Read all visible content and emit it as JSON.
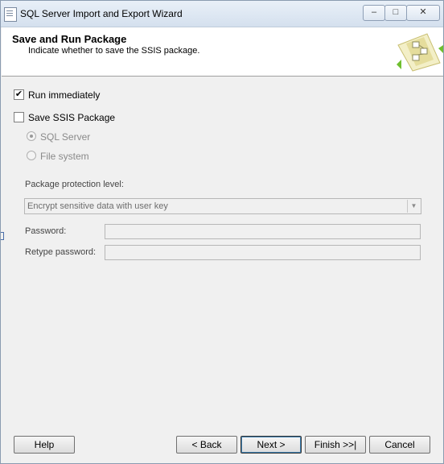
{
  "window": {
    "title": "SQL Server Import and Export Wizard",
    "controls": {
      "minimize": "–",
      "maximize": "□",
      "close": "✕"
    }
  },
  "header": {
    "title": "Save and Run Package",
    "subtitle": "Indicate whether to save the SSIS package.",
    "graphic_icon": "wizard-package-icon"
  },
  "options": {
    "run_immediately": {
      "label": "Run immediately",
      "checked": true
    },
    "save_ssis_package": {
      "label": "Save SSIS Package",
      "checked": false
    },
    "destination": [
      {
        "label": "SQL Server",
        "selected": true,
        "enabled": false
      },
      {
        "label": "File system",
        "selected": false,
        "enabled": false
      }
    ]
  },
  "protection": {
    "label": "Package protection level:",
    "selected": "Encrypt sensitive data with user key",
    "enabled": false
  },
  "password": {
    "label": "Password:",
    "value": ""
  },
  "retype_password": {
    "label": "Retype password:",
    "value": ""
  },
  "buttons": {
    "help": "Help",
    "back": "< Back",
    "next": "Next >",
    "finish": "Finish >>|",
    "cancel": "Cancel"
  },
  "colors": {
    "titlebar": "#dbe5f1",
    "panel": "#f0f0f0",
    "disabled_text": "#8a8a8a"
  }
}
